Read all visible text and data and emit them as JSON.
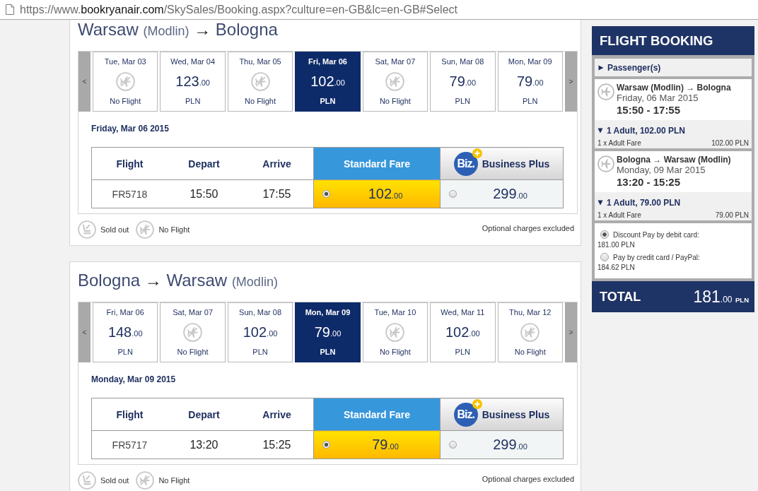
{
  "address_bar": {
    "url_parts": [
      {
        "kind": "dim",
        "text": "https://www."
      },
      {
        "kind": "host",
        "text": "bookryanair.com"
      },
      {
        "kind": "dim",
        "text": "/SkySales/Booking.aspx?culture=en-GB&lc=en-GB#Select"
      }
    ]
  },
  "journeys": [
    {
      "title": [
        {
          "kind": "city",
          "text": "Warsaw"
        },
        {
          "kind": "note",
          "text": "(Modlin)"
        },
        {
          "kind": "arrow",
          "text": "→"
        },
        {
          "kind": "city",
          "text": "Bologna"
        }
      ],
      "prev_button": "<",
      "next_button": ">",
      "dates": [
        {
          "day": "Tue, Mar 03",
          "kind": "no_flight",
          "label": "No Flight",
          "selected": false
        },
        {
          "day": "Wed, Mar 04",
          "kind": "fare",
          "whole": "123",
          "cents": ".00",
          "label": "PLN",
          "selected": false
        },
        {
          "day": "Thu, Mar 05",
          "kind": "no_flight",
          "label": "No Flight",
          "selected": false
        },
        {
          "day": "Fri, Mar 06",
          "kind": "fare",
          "whole": "102",
          "cents": ".00",
          "label": "PLN",
          "selected": true
        },
        {
          "day": "Sat, Mar 07",
          "kind": "no_flight",
          "label": "No Flight",
          "selected": false
        },
        {
          "day": "Sun, Mar 08",
          "kind": "fare",
          "whole": "79",
          "cents": ".00",
          "label": "PLN",
          "selected": false
        },
        {
          "day": "Mon, Mar 09",
          "kind": "fare",
          "whole": "79",
          "cents": ".00",
          "label": "PLN",
          "selected": false
        }
      ],
      "date_heading": "Friday, Mar 06 2015",
      "table": {
        "columns": [
          "Flight",
          "Depart",
          "Arrive"
        ],
        "fare_columns": [
          {
            "kind": "standard",
            "label": "Standard Fare"
          },
          {
            "kind": "business",
            "label": "Business Plus",
            "logo": "Biz."
          }
        ],
        "rows": [
          {
            "flight": "FR5718",
            "depart": "15:50",
            "arrive": "17:55",
            "fares": [
              {
                "whole": "102",
                "cents": ".00",
                "selected": true
              },
              {
                "whole": "299",
                "cents": ".00",
                "selected": false
              }
            ]
          }
        ]
      },
      "legend": [
        {
          "kind": "sold_out",
          "label": "Sold out"
        },
        {
          "kind": "no_flight",
          "label": "No Flight"
        }
      ],
      "note": "Optional charges excluded"
    },
    {
      "title": [
        {
          "kind": "city",
          "text": "Bologna"
        },
        {
          "kind": "arrow",
          "text": "→"
        },
        {
          "kind": "city",
          "text": "Warsaw"
        },
        {
          "kind": "note",
          "text": "(Modlin)"
        }
      ],
      "prev_button": "<",
      "next_button": ">",
      "dates": [
        {
          "day": "Fri, Mar 06",
          "kind": "fare",
          "whole": "148",
          "cents": ".00",
          "label": "PLN",
          "selected": false
        },
        {
          "day": "Sat, Mar 07",
          "kind": "no_flight",
          "label": "No Flight",
          "selected": false
        },
        {
          "day": "Sun, Mar 08",
          "kind": "fare",
          "whole": "102",
          "cents": ".00",
          "label": "PLN",
          "selected": false
        },
        {
          "day": "Mon, Mar 09",
          "kind": "fare",
          "whole": "79",
          "cents": ".00",
          "label": "PLN",
          "selected": true
        },
        {
          "day": "Tue, Mar 10",
          "kind": "no_flight",
          "label": "No Flight",
          "selected": false
        },
        {
          "day": "Wed, Mar 11",
          "kind": "fare",
          "whole": "102",
          "cents": ".00",
          "label": "PLN",
          "selected": false
        },
        {
          "day": "Thu, Mar 12",
          "kind": "no_flight",
          "label": "No Flight",
          "selected": false
        }
      ],
      "date_heading": "Monday, Mar 09 2015",
      "table": {
        "columns": [
          "Flight",
          "Depart",
          "Arrive"
        ],
        "fare_columns": [
          {
            "kind": "standard",
            "label": "Standard Fare"
          },
          {
            "kind": "business",
            "label": "Business Plus",
            "logo": "Biz."
          }
        ],
        "rows": [
          {
            "flight": "FR5717",
            "depart": "13:20",
            "arrive": "15:25",
            "fares": [
              {
                "whole": "79",
                "cents": ".00",
                "selected": true
              },
              {
                "whole": "299",
                "cents": ".00",
                "selected": false
              }
            ]
          }
        ]
      },
      "legend": [
        {
          "kind": "sold_out",
          "label": "Sold out"
        },
        {
          "kind": "no_flight",
          "label": "No Flight"
        }
      ],
      "note": "Optional charges excluded"
    }
  ],
  "sidebar": {
    "title": "FLIGHT BOOKING",
    "passengers": {
      "label": "Passenger(s)",
      "expanded": false
    },
    "flights": [
      {
        "route": "Warsaw (Modlin) → Bologna",
        "date": "Friday, 06 Mar 2015",
        "times": "15:50 - 17:55",
        "fare_summary": {
          "label": "1 Adult, 102.00 PLN",
          "expanded": true,
          "lines": [
            {
              "label": "1 x Adult Fare",
              "amount": "102.00 PLN"
            }
          ]
        }
      },
      {
        "route": "Bologna → Warsaw (Modlin)",
        "date": "Monday, 09 Mar 2015",
        "times": "13:20 - 15:25",
        "fare_summary": {
          "label": "1 Adult, 79.00 PLN",
          "expanded": true,
          "lines": [
            {
              "label": "1 x Adult Fare",
              "amount": "79.00 PLN"
            }
          ]
        }
      }
    ],
    "payment_options": [
      {
        "label": "Discount Pay by debit card:",
        "amount": "181.00 PLN",
        "selected": true
      },
      {
        "label": "Pay by credit card / PayPal:",
        "amount": "184.62 PLN",
        "selected": false
      }
    ],
    "total": {
      "label": "TOTAL",
      "whole": "181",
      "cents": ".00",
      "currency": "PLN"
    }
  }
}
